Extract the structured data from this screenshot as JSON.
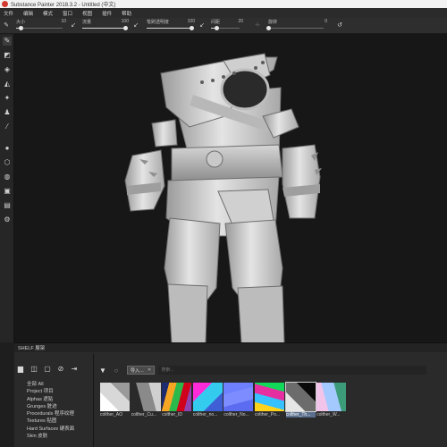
{
  "window": {
    "title": "Substance Painter 2018.3.2 - Untitled (中文)"
  },
  "menu": {
    "items": [
      "文件",
      "编辑",
      "模式",
      "窗口",
      "视图",
      "插件",
      "帮助"
    ]
  },
  "toolbar": {
    "sliders": [
      {
        "label": "大小",
        "value": "10",
        "fraction": 0.1
      },
      {
        "label": "流量",
        "value": "100",
        "fraction": 1.0
      },
      {
        "label": "笔刷透明度",
        "value": "100",
        "fraction": 1.0
      },
      {
        "label": "间距",
        "value": "20",
        "fraction": 0.2
      },
      {
        "label": "旋转",
        "value": "0",
        "fraction": 0.0
      }
    ]
  },
  "left_tools": [
    "brush-icon",
    "eraser-icon",
    "projection-icon",
    "geometry-mask-icon",
    "smudge-icon",
    "clone-icon",
    "color-picker-icon",
    "polygon-fill-icon",
    "bake-icon",
    "material-icon",
    "layer-icon",
    "export-icon",
    "settings-icon"
  ],
  "shelf": {
    "header": "SHELF 展架",
    "categories": [
      "全部 All",
      "Project 项目",
      "Alphas 遮贴",
      "Grunges 脏迹",
      "Procedurals 程序纹理",
      "Textures 贴图",
      "Hard Surfaces 硬表面",
      "Skin 皮肤"
    ],
    "filter_chip": "导入…",
    "search": {
      "placeholder": "搜索..."
    },
    "thumbnails": [
      {
        "name": "colther_AO",
        "palette": [
          "#ffffff",
          "#d8d8d8",
          "#9a9a9a"
        ]
      },
      {
        "name": "colther_Cu...",
        "palette": [
          "#2a2a2a",
          "#8a8a8a",
          "#cfcfcf"
        ]
      },
      {
        "name": "colther_ID",
        "palette": [
          "#1d2b6f",
          "#f5a623",
          "#2cb94b",
          "#d0021b",
          "#8e44ad"
        ]
      },
      {
        "name": "colther_no...",
        "palette": [
          "#ff2bd9",
          "#33ccee",
          "#3e5fd6"
        ]
      },
      {
        "name": "colther_No...",
        "palette": [
          "#6f80ff",
          "#7d8cff",
          "#5c6cf0"
        ]
      },
      {
        "name": "colther_Po...",
        "palette": [
          "#12d85a",
          "#e62ea1",
          "#37c2ff",
          "#ffd31a"
        ]
      },
      {
        "name": "colther_Th...",
        "palette": [
          "#0a0a0a",
          "#6c6c6c",
          "#e6e6e6"
        ],
        "selected": true
      },
      {
        "name": "colther_W...",
        "palette": [
          "#3c9b79",
          "#a3c9ff",
          "#f2c4ea"
        ]
      }
    ]
  }
}
